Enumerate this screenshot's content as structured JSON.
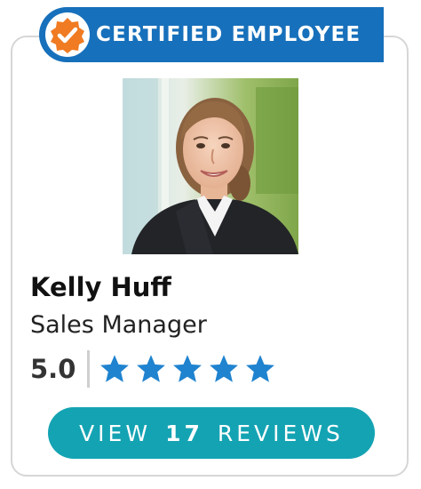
{
  "badge": {
    "label": "CERTIFIED EMPLOYEE",
    "icon": "certified-check-seal-icon",
    "color": "#1770bb",
    "seal_color": "#f07b22"
  },
  "profile": {
    "photo_alt": "Kelly Huff",
    "name": "Kelly Huff",
    "job_title": "Sales Manager",
    "rating": "5.0",
    "stars": 5,
    "star_color": "#1f83cf"
  },
  "reviews_button": {
    "prefix": "VIEW",
    "count": "17",
    "suffix": "REVIEWS",
    "color": "#14a3b3"
  }
}
